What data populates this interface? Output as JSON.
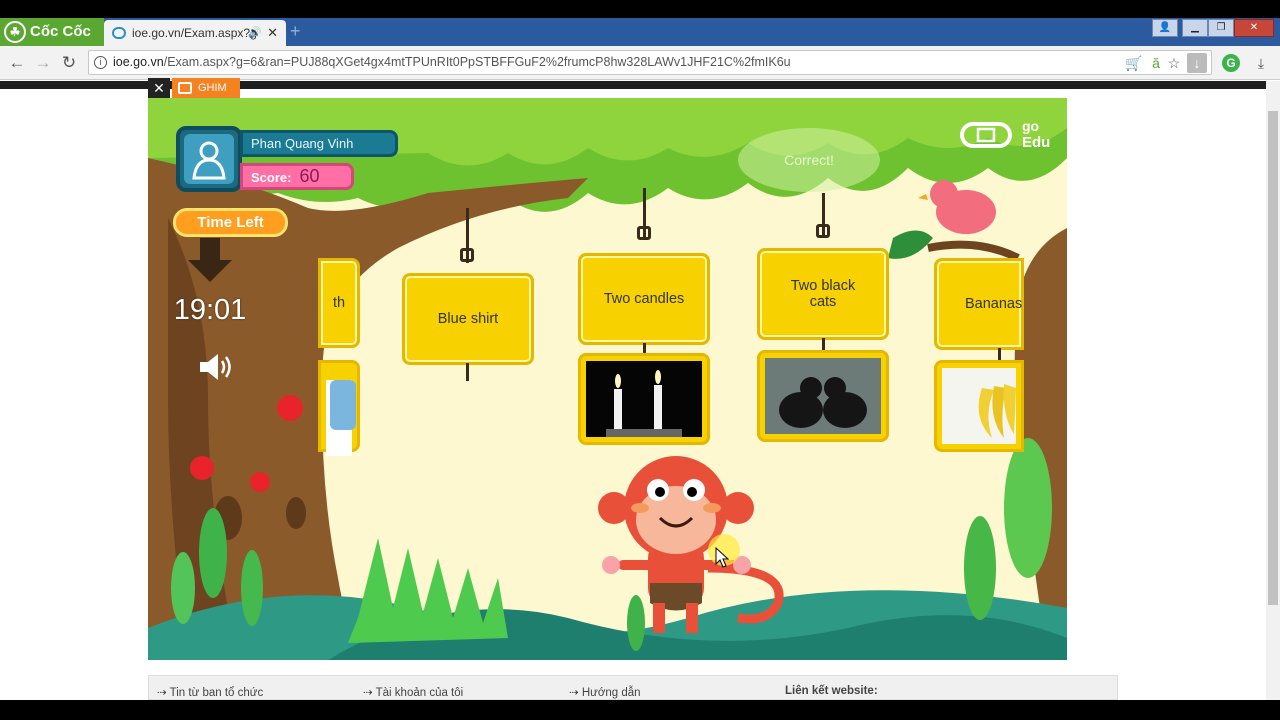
{
  "browser": {
    "brand_label": "Cốc Cốc",
    "tab_title": "ioe.go.vn/Exam.aspx?g",
    "new_tab_symbol": "+",
    "address_host": "ioe.go.vn",
    "address_path": "/Exam.aspx?g=6&ran=PUJ88qXGet4gx4mtTPUnRIt0PpSTBFFGuF2%2frumcP8hw328LAWv1JHF21C%2fmIK6u"
  },
  "ad": {
    "close_label": "✕",
    "ghim_label": "GHIM"
  },
  "player": {
    "name": "Phan Quang Vinh",
    "score_label": "Score:",
    "score_value": "60"
  },
  "timer": {
    "label": "Time Left",
    "value": "19:01"
  },
  "feedback": {
    "text": "Correct!"
  },
  "logo": {
    "go": "go",
    "edu": "Edu"
  },
  "cards": [
    {
      "text": "th"
    },
    {
      "text": "Blue shirt"
    },
    {
      "text": "Two candles"
    },
    {
      "text": "Two black cats"
    },
    {
      "text": "Bananas"
    }
  ],
  "footer": {
    "links": [
      "Tin từ ban tổ chức",
      "Tài khoản của tôi",
      "Hướng dẫn"
    ],
    "website_label": "Liên kết website:"
  },
  "colors": {
    "tabstrip": "#2b5a9e",
    "brand_green": "#5aa832",
    "card_yellow": "#f7d200",
    "score_pink": "#ff6fa6",
    "name_teal": "#1b7a94",
    "time_orange": "#ff9e1f"
  }
}
